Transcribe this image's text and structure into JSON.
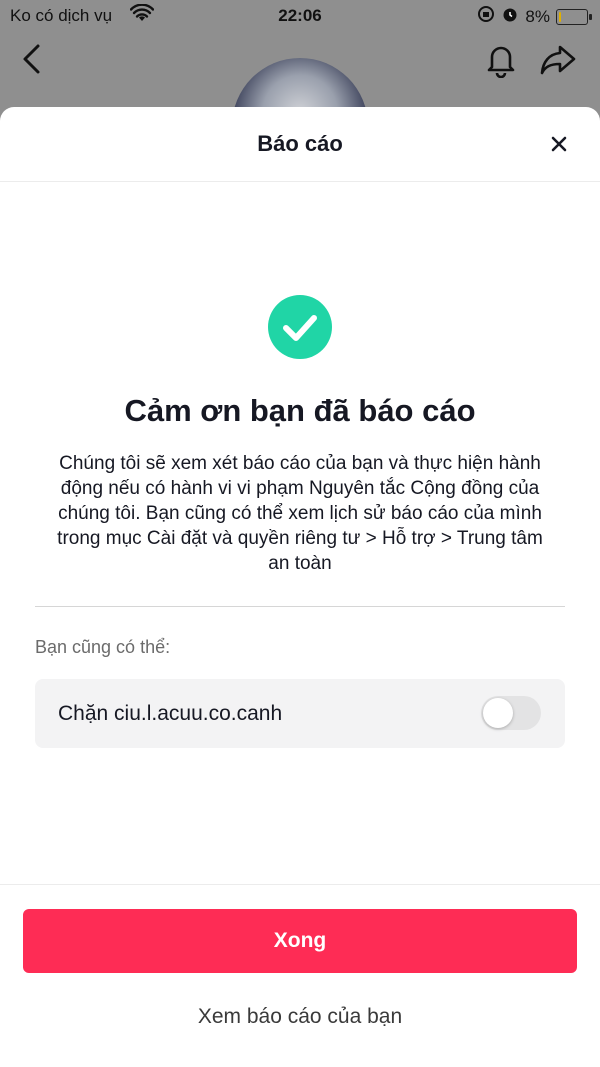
{
  "status_bar": {
    "carrier": "Ko có dịch vụ",
    "time": "22:06",
    "battery_percent": "8%",
    "battery_level": 0.08,
    "battery_color": "#e0b000"
  },
  "background_nav": {
    "back_icon": "chevron-left-icon",
    "bell_icon": "bell-icon",
    "share_icon": "share-arrow-icon"
  },
  "sheet": {
    "title": "Báo cáo",
    "close_icon": "close-icon",
    "success_icon": "check-circle-icon",
    "success_color": "#20d5a6",
    "heading": "Cảm ơn bạn đã báo cáo",
    "body_lines": [
      "Chúng tôi sẽ xem xét báo cáo của bạn và thực hiện hành",
      "động nếu có hành vi vi phạm Nguyên tắc Cộng đồng của",
      "chúng tôi. Bạn cũng có thể xem lịch sử báo cáo của mình",
      "trong mục Cài đặt và quyền riêng tư > Hỗ trợ > Trung tâm",
      "an toàn"
    ],
    "also_label": "Bạn cũng có thể:",
    "block_label": "Chặn ciu.l.acuu.co.canh",
    "block_toggle_on": false,
    "done_label": "Xong",
    "done_color": "#fe2c55",
    "view_reports_label": "Xem báo cáo của bạn"
  }
}
